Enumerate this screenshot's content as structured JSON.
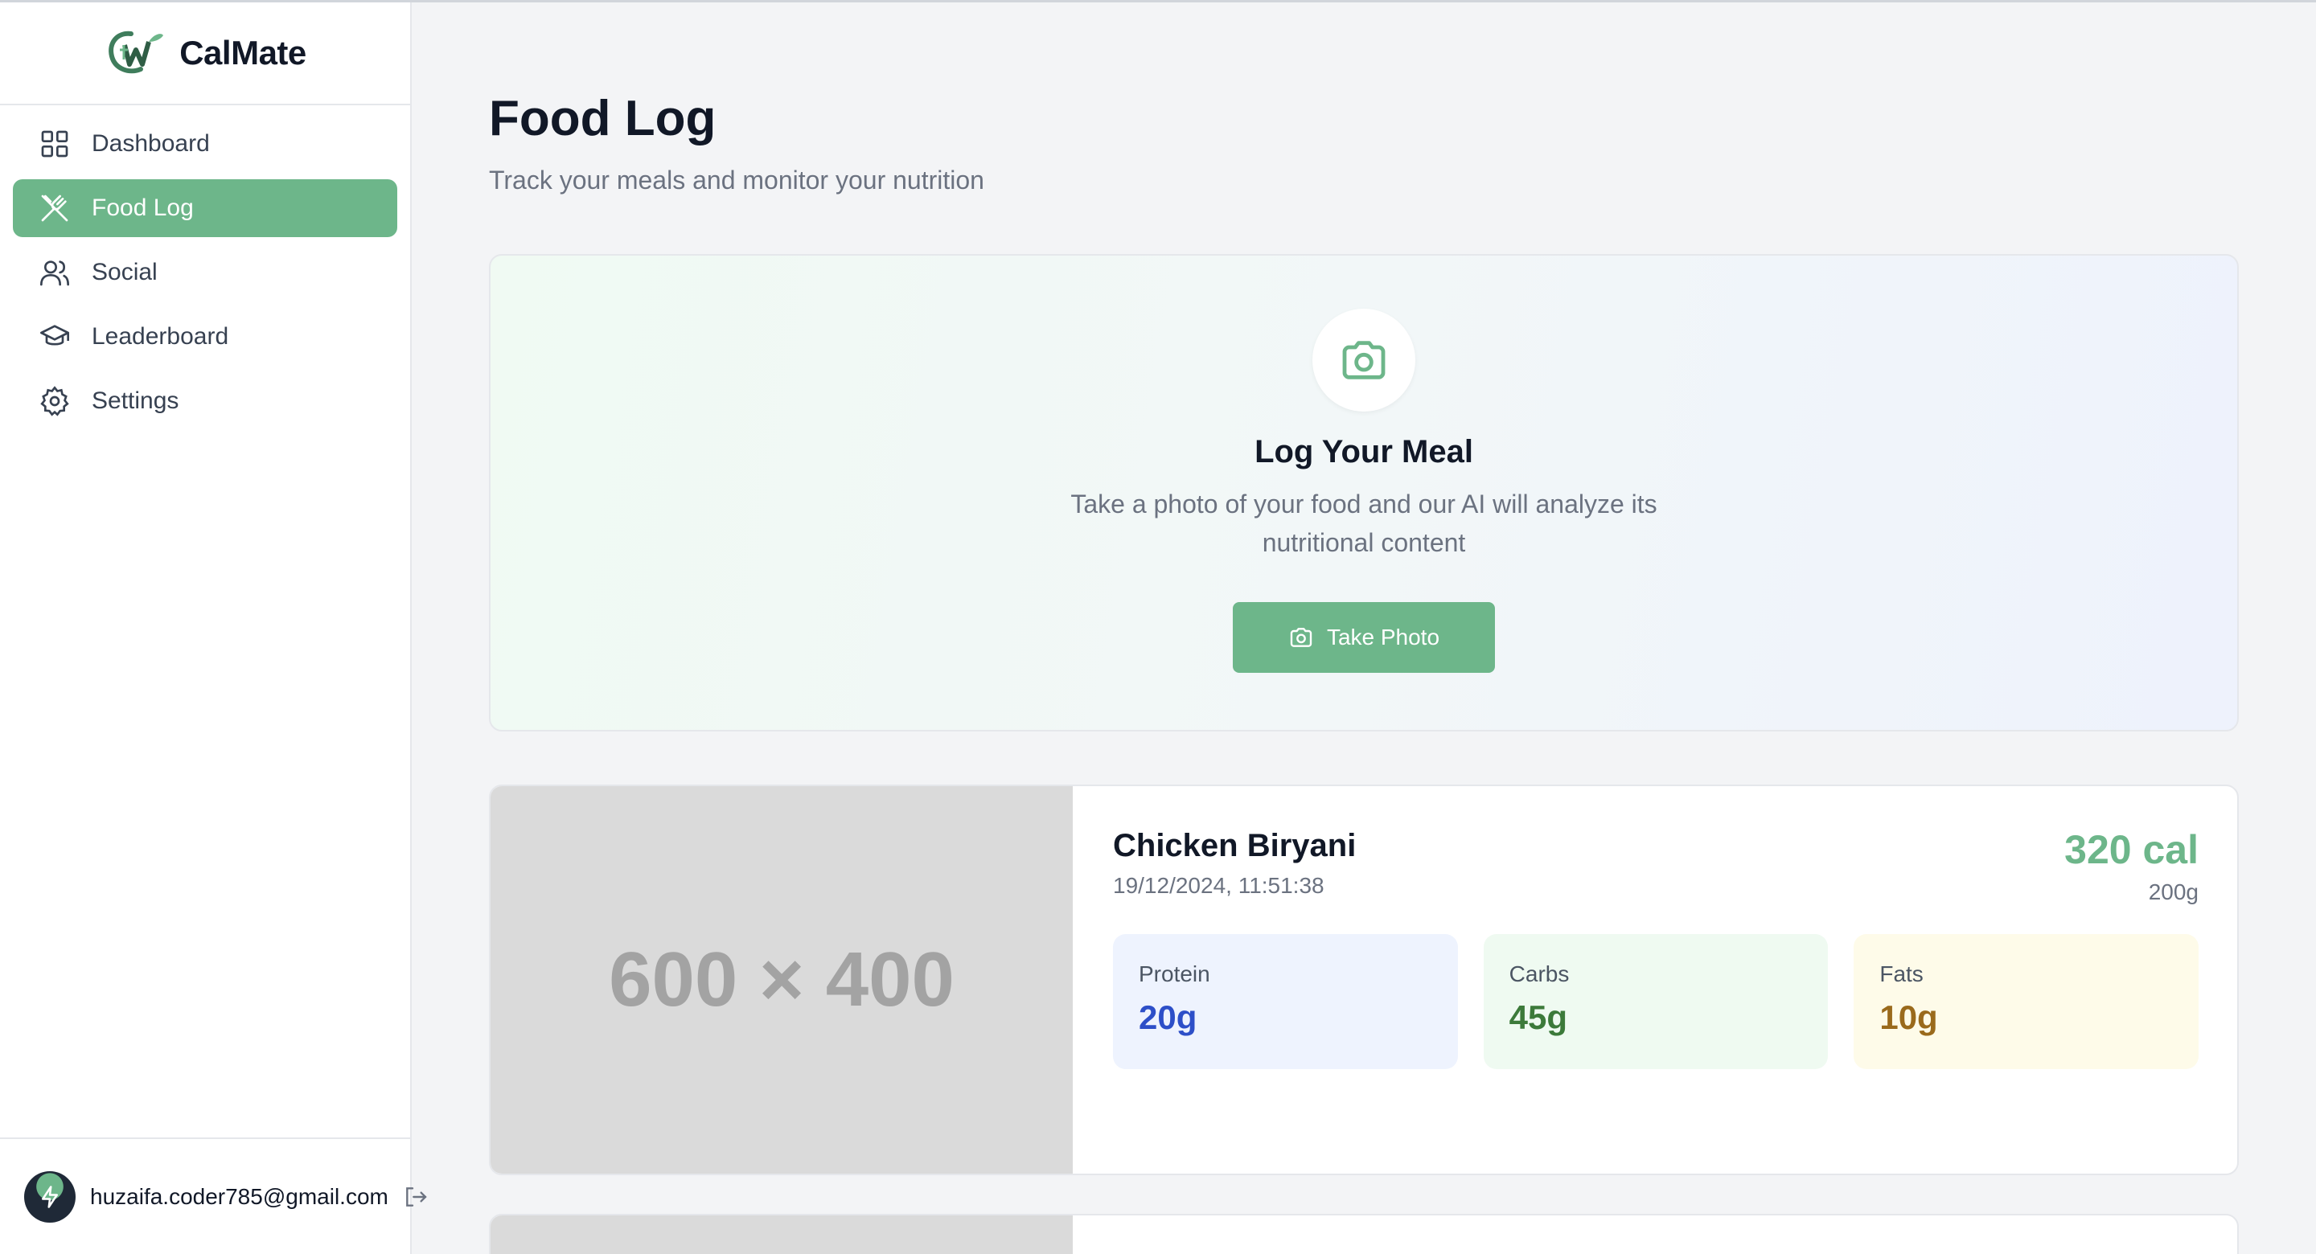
{
  "app": {
    "name": "CalMate"
  },
  "sidebar": {
    "items": [
      {
        "label": "Dashboard",
        "icon": "grid-icon",
        "active": false
      },
      {
        "label": "Food Log",
        "icon": "utensils-crossed-icon",
        "active": true
      },
      {
        "label": "Social",
        "icon": "users-icon",
        "active": false
      },
      {
        "label": "Leaderboard",
        "icon": "graduation-cap-icon",
        "active": false
      },
      {
        "label": "Settings",
        "icon": "gear-icon",
        "active": false
      }
    ],
    "user": {
      "email": "huzaifa.coder785@gmail.com"
    }
  },
  "page": {
    "title": "Food Log",
    "subtitle": "Track your meals and monitor your nutrition"
  },
  "log_meal": {
    "title": "Log Your Meal",
    "description": "Take a photo of your food and our AI will analyze its nutritional content",
    "button_label": "Take Photo"
  },
  "entries": [
    {
      "image_placeholder": "600 × 400",
      "name": "Chicken Biryani",
      "datetime": "19/12/2024, 11:51:38",
      "calories": "320 cal",
      "weight": "200g",
      "macros": {
        "protein": {
          "label": "Protein",
          "value": "20g"
        },
        "carbs": {
          "label": "Carbs",
          "value": "45g"
        },
        "fats": {
          "label": "Fats",
          "value": "10g"
        }
      }
    }
  ],
  "colors": {
    "accent": "#6db68a",
    "protein": "#2d4fc8",
    "carbs": "#3c7a3a",
    "fats": "#9a6a1c"
  }
}
